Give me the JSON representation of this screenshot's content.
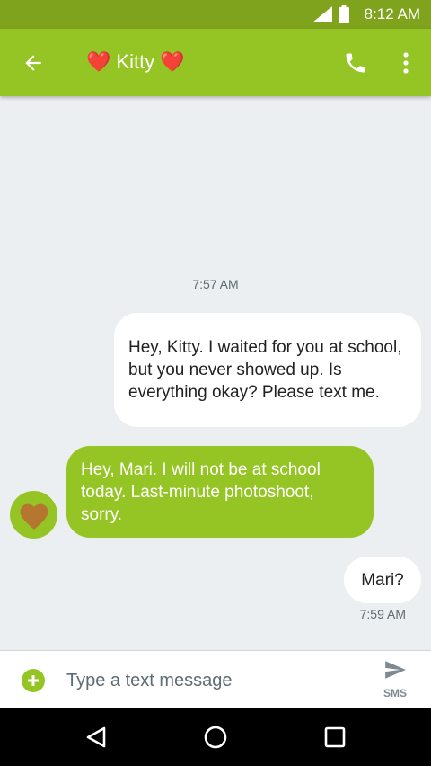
{
  "status_bar": {
    "time": "8:12 AM"
  },
  "header": {
    "title": "Kitty",
    "title_emoji": "❤️"
  },
  "conversation": {
    "messages": [
      {
        "direction": "outgoing",
        "text": "Hey, Kitty. I waited for you at school, but you never showed up. Is everything okay? Please text me."
      },
      {
        "direction": "incoming",
        "text": "Hey, Mari. I will not be at school today. Last-minute photoshoot, sorry."
      },
      {
        "direction": "outgoing",
        "text": "Mari?"
      }
    ],
    "timestamps": [
      "7:57 AM",
      "7:59 AM"
    ]
  },
  "compose": {
    "placeholder": "Type a text message",
    "send_label": "SMS"
  },
  "icons": {
    "back": "arrow-back-icon",
    "call": "phone-icon",
    "more": "more-vert-icon",
    "add": "add-circle-icon",
    "send": "send-icon",
    "avatar": "brown-heart-icon"
  },
  "colors": {
    "status_bar": "#7fa31c",
    "app_bar": "#95c525",
    "incoming_bubble": "#95c525",
    "outgoing_bubble": "#ffffff",
    "conversation_bg": "#eceff1"
  }
}
